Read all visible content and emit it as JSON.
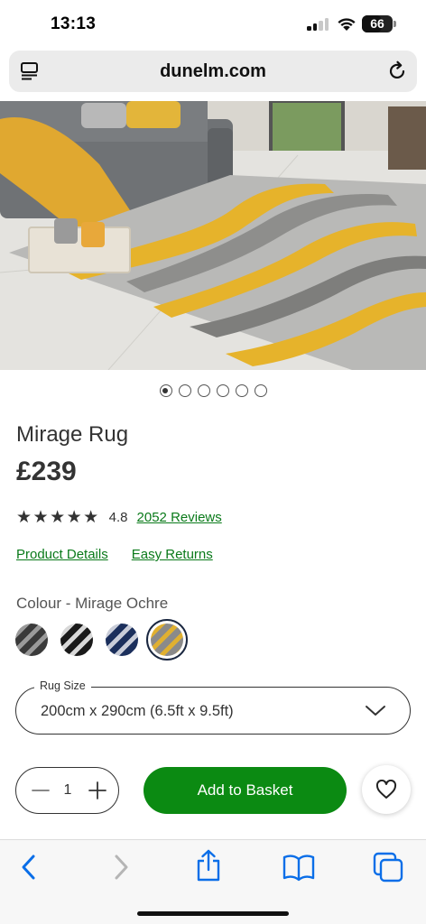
{
  "status_bar": {
    "time": "13:13",
    "battery": "66",
    "battery_level": 0.66,
    "signal_bars": 4,
    "signal_active": 2
  },
  "browser": {
    "url": "dunelm.com",
    "icons": [
      "reader-mode-icon",
      "reload-icon"
    ]
  },
  "product": {
    "image_count": 6,
    "active_image": 1,
    "title": "Mirage Rug",
    "price": "£239",
    "stars": "★★★★★",
    "rating": "4.8",
    "reviews_link": "2052 Reviews",
    "details_link": "Product Details",
    "returns_link": "Easy Returns",
    "colour_label": "Colour - Mirage Ochre",
    "swatches": [
      {
        "name": "Mirage Charcoal",
        "colors": [
          "#3a3a3a",
          "#9a9a9a"
        ],
        "selected": false
      },
      {
        "name": "Mirage Black",
        "colors": [
          "#1a1a1a",
          "#d8d8d8"
        ],
        "selected": false
      },
      {
        "name": "Mirage Navy",
        "colors": [
          "#1b2f5c",
          "#c8ccd8"
        ],
        "selected": false
      },
      {
        "name": "Mirage Ochre",
        "colors": [
          "#8a8a8a",
          "#e0b030"
        ],
        "selected": true
      }
    ],
    "size_label": "Rug Size",
    "size_value": "200cm x 290cm (6.5ft x 9.5ft)",
    "quantity": "1",
    "add_to_basket": "Add to Basket"
  },
  "toolbar": {
    "icons": [
      "back-icon",
      "forward-icon",
      "share-icon",
      "bookmarks-icon",
      "tabs-icon"
    ]
  },
  "colors": {
    "accent_green": "#0b8a12",
    "link_green": "#0a7a1a",
    "safari_blue": "#0a6ee8"
  }
}
